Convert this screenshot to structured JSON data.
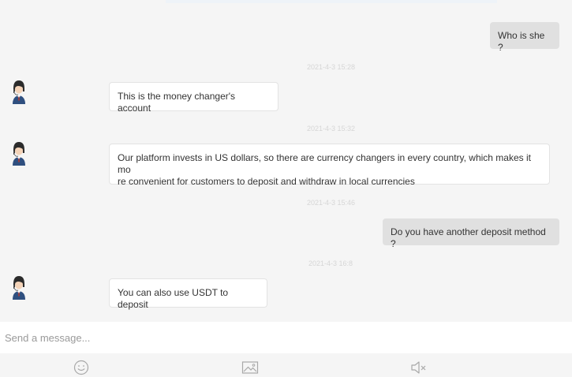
{
  "messages": [
    {
      "sender": "user",
      "text": "Who is she ?"
    },
    {
      "timestamp": "2021-4-3 15:28",
      "sender": "agent",
      "avatar_icon": "customer-service-agent-avatar",
      "text": "This is the money changer's account"
    },
    {
      "timestamp": "2021-4-3 15:32",
      "sender": "agent",
      "avatar_icon": "customer-service-agent-avatar",
      "text_line1": "Our platform invests in US dollars, so there are currency changers in every country, which makes it mo",
      "text_line2": "re convenient for customers to deposit and withdraw in local currencies"
    },
    {
      "timestamp": "2021-4-3 15:46",
      "sender": "user",
      "text": "Do you have another deposit method ?"
    },
    {
      "timestamp": "2021-4-3 16:8",
      "sender": "agent",
      "avatar_icon": "customer-service-agent-avatar",
      "text": "You can also use USDT to deposit"
    }
  ],
  "composer": {
    "placeholder": "Send a message..."
  },
  "toolbar": {
    "icons": [
      "emoji-icon",
      "image-icon",
      "speaker-mute-icon"
    ]
  },
  "colors": {
    "background": "#f5f5f5",
    "user_bubble": "#e0e0e0",
    "agent_bubble": "#ffffff",
    "timestamp": "#d6d6d6",
    "icon": "#a8a8a8"
  }
}
